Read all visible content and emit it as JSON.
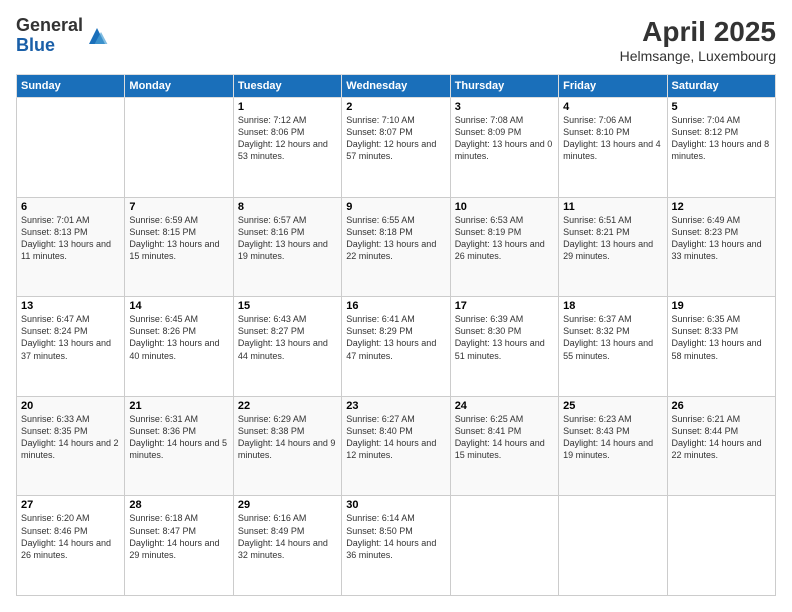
{
  "header": {
    "logo": {
      "line1": "General",
      "line2": "Blue"
    },
    "title": "April 2025",
    "subtitle": "Helmsange, Luxembourg"
  },
  "days_of_week": [
    "Sunday",
    "Monday",
    "Tuesday",
    "Wednesday",
    "Thursday",
    "Friday",
    "Saturday"
  ],
  "weeks": [
    [
      {
        "day": "",
        "info": ""
      },
      {
        "day": "",
        "info": ""
      },
      {
        "day": "1",
        "info": "Sunrise: 7:12 AM\nSunset: 8:06 PM\nDaylight: 12 hours and 53 minutes."
      },
      {
        "day": "2",
        "info": "Sunrise: 7:10 AM\nSunset: 8:07 PM\nDaylight: 12 hours and 57 minutes."
      },
      {
        "day": "3",
        "info": "Sunrise: 7:08 AM\nSunset: 8:09 PM\nDaylight: 13 hours and 0 minutes."
      },
      {
        "day": "4",
        "info": "Sunrise: 7:06 AM\nSunset: 8:10 PM\nDaylight: 13 hours and 4 minutes."
      },
      {
        "day": "5",
        "info": "Sunrise: 7:04 AM\nSunset: 8:12 PM\nDaylight: 13 hours and 8 minutes."
      }
    ],
    [
      {
        "day": "6",
        "info": "Sunrise: 7:01 AM\nSunset: 8:13 PM\nDaylight: 13 hours and 11 minutes."
      },
      {
        "day": "7",
        "info": "Sunrise: 6:59 AM\nSunset: 8:15 PM\nDaylight: 13 hours and 15 minutes."
      },
      {
        "day": "8",
        "info": "Sunrise: 6:57 AM\nSunset: 8:16 PM\nDaylight: 13 hours and 19 minutes."
      },
      {
        "day": "9",
        "info": "Sunrise: 6:55 AM\nSunset: 8:18 PM\nDaylight: 13 hours and 22 minutes."
      },
      {
        "day": "10",
        "info": "Sunrise: 6:53 AM\nSunset: 8:19 PM\nDaylight: 13 hours and 26 minutes."
      },
      {
        "day": "11",
        "info": "Sunrise: 6:51 AM\nSunset: 8:21 PM\nDaylight: 13 hours and 29 minutes."
      },
      {
        "day": "12",
        "info": "Sunrise: 6:49 AM\nSunset: 8:23 PM\nDaylight: 13 hours and 33 minutes."
      }
    ],
    [
      {
        "day": "13",
        "info": "Sunrise: 6:47 AM\nSunset: 8:24 PM\nDaylight: 13 hours and 37 minutes."
      },
      {
        "day": "14",
        "info": "Sunrise: 6:45 AM\nSunset: 8:26 PM\nDaylight: 13 hours and 40 minutes."
      },
      {
        "day": "15",
        "info": "Sunrise: 6:43 AM\nSunset: 8:27 PM\nDaylight: 13 hours and 44 minutes."
      },
      {
        "day": "16",
        "info": "Sunrise: 6:41 AM\nSunset: 8:29 PM\nDaylight: 13 hours and 47 minutes."
      },
      {
        "day": "17",
        "info": "Sunrise: 6:39 AM\nSunset: 8:30 PM\nDaylight: 13 hours and 51 minutes."
      },
      {
        "day": "18",
        "info": "Sunrise: 6:37 AM\nSunset: 8:32 PM\nDaylight: 13 hours and 55 minutes."
      },
      {
        "day": "19",
        "info": "Sunrise: 6:35 AM\nSunset: 8:33 PM\nDaylight: 13 hours and 58 minutes."
      }
    ],
    [
      {
        "day": "20",
        "info": "Sunrise: 6:33 AM\nSunset: 8:35 PM\nDaylight: 14 hours and 2 minutes."
      },
      {
        "day": "21",
        "info": "Sunrise: 6:31 AM\nSunset: 8:36 PM\nDaylight: 14 hours and 5 minutes."
      },
      {
        "day": "22",
        "info": "Sunrise: 6:29 AM\nSunset: 8:38 PM\nDaylight: 14 hours and 9 minutes."
      },
      {
        "day": "23",
        "info": "Sunrise: 6:27 AM\nSunset: 8:40 PM\nDaylight: 14 hours and 12 minutes."
      },
      {
        "day": "24",
        "info": "Sunrise: 6:25 AM\nSunset: 8:41 PM\nDaylight: 14 hours and 15 minutes."
      },
      {
        "day": "25",
        "info": "Sunrise: 6:23 AM\nSunset: 8:43 PM\nDaylight: 14 hours and 19 minutes."
      },
      {
        "day": "26",
        "info": "Sunrise: 6:21 AM\nSunset: 8:44 PM\nDaylight: 14 hours and 22 minutes."
      }
    ],
    [
      {
        "day": "27",
        "info": "Sunrise: 6:20 AM\nSunset: 8:46 PM\nDaylight: 14 hours and 26 minutes."
      },
      {
        "day": "28",
        "info": "Sunrise: 6:18 AM\nSunset: 8:47 PM\nDaylight: 14 hours and 29 minutes."
      },
      {
        "day": "29",
        "info": "Sunrise: 6:16 AM\nSunset: 8:49 PM\nDaylight: 14 hours and 32 minutes."
      },
      {
        "day": "30",
        "info": "Sunrise: 6:14 AM\nSunset: 8:50 PM\nDaylight: 14 hours and 36 minutes."
      },
      {
        "day": "",
        "info": ""
      },
      {
        "day": "",
        "info": ""
      },
      {
        "day": "",
        "info": ""
      }
    ]
  ]
}
